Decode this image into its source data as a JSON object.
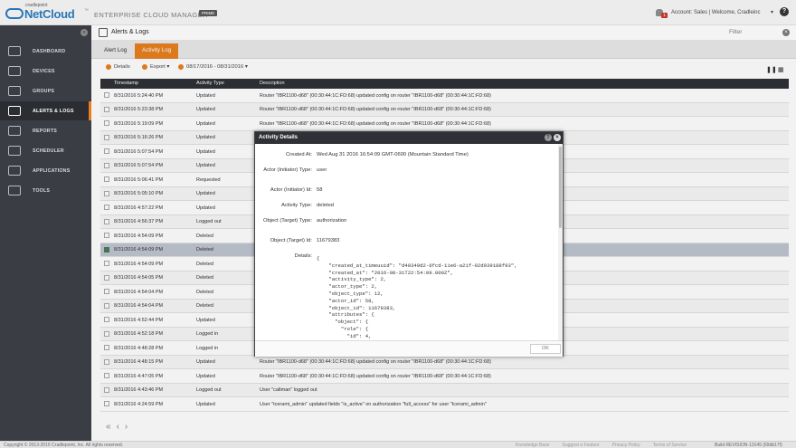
{
  "brand": {
    "small": "cradlepoint",
    "name": "NetCloud",
    "tm": "™",
    "product": "ENTERPRISE CLOUD MANAGER",
    "tier": "PRIME"
  },
  "topbar": {
    "notifications": "1",
    "account": "Account: Sales  |  Welcome, Cradleinc",
    "account_caret": "▾",
    "help": "?"
  },
  "sidebar": {
    "collapse": "«",
    "items": [
      {
        "label": "DASHBOARD",
        "icon": "dashboard-icon"
      },
      {
        "label": "DEVICES",
        "icon": "devices-icon"
      },
      {
        "label": "GROUPS",
        "icon": "groups-icon"
      },
      {
        "label": "ALERTS & LOGS",
        "icon": "alerts-logs-icon",
        "active": true
      },
      {
        "label": "REPORTS",
        "icon": "reports-icon"
      },
      {
        "label": "SCHEDULER",
        "icon": "scheduler-icon"
      },
      {
        "label": "APPLICATIONS",
        "icon": "applications-icon"
      },
      {
        "label": "TOOLS",
        "icon": "tools-icon"
      }
    ]
  },
  "header": {
    "title": "Alerts & Logs",
    "filter": "Filter",
    "close": "×"
  },
  "tabs": [
    "Alert Log",
    "Activity Log"
  ],
  "toolbar": {
    "details": "Details",
    "export": "Export",
    "export_caret": "▾",
    "date_range": "08/17/2016 - 08/31/2016",
    "date_caret": "▾",
    "pause": "❚❚",
    "columns": "▦"
  },
  "table": {
    "columns": [
      "Timestamp",
      "Activity Type",
      "Description"
    ],
    "rows": [
      {
        "ts": "8/31/2016 5:24:40 PM",
        "type": "Updated",
        "desc": "Router \"IBR1100-d68\" (00:30:44:1C:FD:68) updated config on router \"IBR1100-d68\" (00:30:44:1C:FD:68)"
      },
      {
        "ts": "8/31/2016 5:23:38 PM",
        "type": "Updated",
        "desc": "Router \"IBR1100-d68\" (00:30:44:1C:FD:68) updated config on router \"IBR1100-d68\" (00:30:44:1C:FD:68)"
      },
      {
        "ts": "8/31/2016 5:19:09 PM",
        "type": "Updated",
        "desc": "Router \"IBR1100-d68\" (00:30:44:1C:FD:68) updated config on router \"IBR1100-d68\" (00:30:44:1C:FD:68)"
      },
      {
        "ts": "8/31/2016 5:16:26 PM",
        "type": "Updated",
        "desc": ""
      },
      {
        "ts": "8/31/2016 5:07:54 PM",
        "type": "Updated",
        "desc": ""
      },
      {
        "ts": "8/31/2016 5:07:54 PM",
        "type": "Updated",
        "desc": ""
      },
      {
        "ts": "8/31/2016 5:06:41 PM",
        "type": "Requested",
        "desc": ""
      },
      {
        "ts": "8/31/2016 5:05:10 PM",
        "type": "Updated",
        "desc": ""
      },
      {
        "ts": "8/31/2016 4:57:22 PM",
        "type": "Updated",
        "desc": ""
      },
      {
        "ts": "8/31/2016 4:56:37 PM",
        "type": "Logged out",
        "desc": ""
      },
      {
        "ts": "8/31/2016 4:54:09 PM",
        "type": "Deleted",
        "desc": ""
      },
      {
        "ts": "8/31/2016 4:54:09 PM",
        "type": "Deleted",
        "desc": "",
        "selected": true
      },
      {
        "ts": "8/31/2016 4:54:09 PM",
        "type": "Deleted",
        "desc": ""
      },
      {
        "ts": "8/31/2016 4:54:05 PM",
        "type": "Deleted",
        "desc": ""
      },
      {
        "ts": "8/31/2016 4:54:04 PM",
        "type": "Deleted",
        "desc": ""
      },
      {
        "ts": "8/31/2016 4:54:04 PM",
        "type": "Deleted",
        "desc": ""
      },
      {
        "ts": "8/31/2016 4:52:44 PM",
        "type": "Updated",
        "desc": ""
      },
      {
        "ts": "8/31/2016 4:52:18 PM",
        "type": "Logged in",
        "desc": ""
      },
      {
        "ts": "8/31/2016 4:48:28 PM",
        "type": "Logged in",
        "desc": ""
      },
      {
        "ts": "8/31/2016 4:48:15 PM",
        "type": "Updated",
        "desc": "Router \"IBR1100-d68\" (00:30:44:1C:FD:68) updated config on router \"IBR1100-d68\" (00:30:44:1C:FD:68)"
      },
      {
        "ts": "8/31/2016 4:47:05 PM",
        "type": "Updated",
        "desc": "Router \"IBR1100-d68\" (00:30:44:1C:FD:68) updated config on router \"IBR1100-d68\" (00:30:44:1C:FD:68)"
      },
      {
        "ts": "8/31/2016 4:43:46 PM",
        "type": "Logged out",
        "desc": "User \"caltman\" logged out"
      },
      {
        "ts": "8/31/2016 4:24:59 PM",
        "type": "Updated",
        "desc": "User \"tcerami_admin\" updated fields \"is_active\" on authorization \"full_access\" for user \"tcerami_admin\""
      }
    ]
  },
  "pager": {
    "first": "«",
    "prev": "‹",
    "next": "›"
  },
  "modal": {
    "title": "Activity Details",
    "fields": [
      {
        "label": "Created At:",
        "value": "Wed Aug 31 2016 16:54:09 GMT-0600 (Mountain Standard Time)"
      },
      {
        "label": "Actor (Initiator) Type:",
        "value": "user"
      },
      {
        "label": "Actor (Initiator) Id:",
        "value": "58"
      },
      {
        "label": "Activity Type:",
        "value": "deleted"
      },
      {
        "label": "Object (Target) Type:",
        "value": "authorization"
      },
      {
        "label": "Object (Target) Id:",
        "value": "11679383"
      },
      {
        "label": "Details:",
        "value": ""
      }
    ],
    "details_json": "{\n    \"created_at_timeuuid\": \"d40349d2-6fcd-11e6-a21f-02d939188f93\",\n    \"created_at\": \"2016-08-31T22:54:09.000Z\",\n    \"activity_type\": 2,\n    \"actor_type\": 2,\n    \"object_type\": 12,\n    \"actor_id\": 58,\n    \"object_id\": 11679383,\n    \"attributes\": {\n      \"object\": {\n        \"role\": {\n          \"id\": 4,",
    "ok": "OK"
  },
  "footer": {
    "copyright": "Copyright © 2013-2016 Cradlepoint, Inc. All rights reserved.",
    "links": [
      "Knowledge Base",
      "Suggest a Feature",
      "Privacy Policy",
      "Terms of Service"
    ],
    "build": "Build REVISION-13145 (69db17f)"
  }
}
